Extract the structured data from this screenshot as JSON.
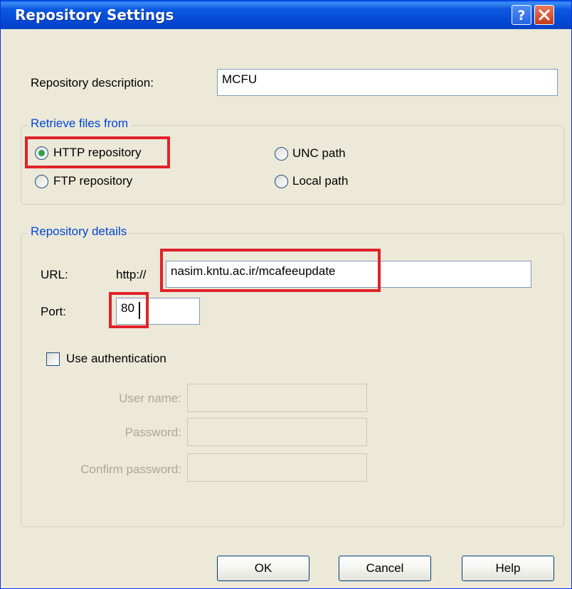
{
  "window": {
    "title": "Repository Settings",
    "help_icon": "help-question-icon",
    "close_icon": "close-x-icon",
    "title_color": "#0a5ff0"
  },
  "description": {
    "label": "Repository description:",
    "value": "MCFU"
  },
  "retrieve": {
    "legend": "Retrieve files from",
    "options": [
      {
        "label": "HTTP repository",
        "selected": true
      },
      {
        "label": "FTP repository",
        "selected": false
      },
      {
        "label": "UNC path",
        "selected": false
      },
      {
        "label": "Local path",
        "selected": false
      }
    ]
  },
  "details": {
    "legend": "Repository details",
    "url_label": "URL:",
    "url_prefix": "http://",
    "url_value": "nasim.kntu.ac.ir/mcafeeupdate",
    "port_label": "Port:",
    "port_value": "80",
    "use_auth_label": "Use authentication",
    "use_auth_checked": false,
    "username_label": "User name:",
    "username_value": "",
    "password_label": "Password:",
    "password_value": "",
    "confirm_label": "Confirm password:",
    "confirm_value": ""
  },
  "buttons": {
    "ok": "OK",
    "cancel": "Cancel",
    "help": "Help"
  },
  "colors": {
    "highlight": "#e0222a",
    "legend": "#0046d5",
    "dialog_bg": "#ece9d8"
  }
}
